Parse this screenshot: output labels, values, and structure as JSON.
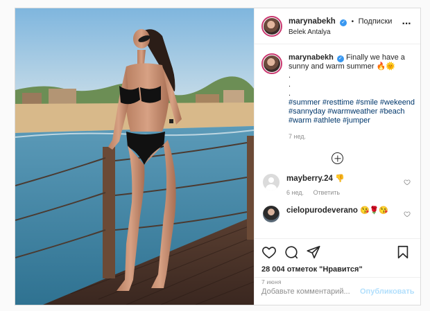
{
  "post": {
    "author": "marynabekh",
    "follow_label": "Подписки",
    "location": "Belek Antalya",
    "caption": {
      "line1": "Finally we have a",
      "line2": "sunny and warm summer",
      "emojis": "🔥🌞",
      "dots": [
        ".",
        ".",
        "."
      ],
      "hashtags": [
        "#summer",
        "#resttime",
        "#smile",
        "#wekeend",
        "#sannyday",
        "#warmweather",
        "#beach",
        "#warm",
        "#athlete",
        "#jumper"
      ],
      "age": "7 нед."
    }
  },
  "comments": [
    {
      "user": "mayberry.24",
      "text": "👎",
      "time": "6 нед.",
      "reply_label": "Ответить"
    },
    {
      "user": "cielopurodeverano",
      "text": "😘🌹😘"
    }
  ],
  "actions": {
    "likes_text": "28 004 отметок \"Нравится\"",
    "date": "7 июня"
  },
  "add_comment": {
    "placeholder": "Добавьте комментарий...",
    "publish_label": "Опубликовать"
  },
  "icons": {
    "verified": "verified-badge-icon",
    "more": "more-options-icon",
    "load_more": "load-more-comments-icon",
    "like": "heart-icon",
    "comment": "comment-icon",
    "share": "share-icon",
    "save": "bookmark-icon"
  },
  "colors": {
    "accent_blue": "#3897f0",
    "hashtag": "#00376b",
    "muted": "#8e8e8e",
    "publish_disabled": "#b2dffc"
  }
}
